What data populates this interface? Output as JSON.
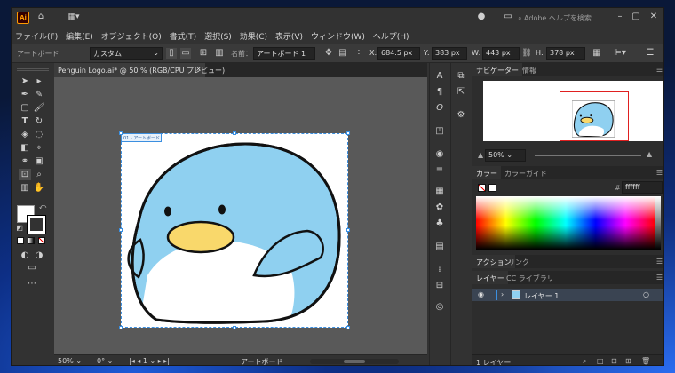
{
  "app": {
    "logo": "Ai"
  },
  "search": {
    "placeholder": "Adobe ヘルプを検索"
  },
  "menu": [
    "ファイル(F)",
    "編集(E)",
    "オブジェクト(O)",
    "書式(T)",
    "選択(S)",
    "効果(C)",
    "表示(V)",
    "ウィンドウ(W)",
    "ヘルプ(H)"
  ],
  "control": {
    "label": "アートボード",
    "preset": "カスタム",
    "name_label": "名前：",
    "name_value": "アートボード 1",
    "x_label": "X:",
    "x_value": "684.5 px",
    "y_label": "Y:",
    "y_value": "383 px",
    "w_label": "W:",
    "w_value": "443 px",
    "h_label": "H:",
    "h_value": "378 px"
  },
  "document_tab": {
    "title": "Penguin Logo.ai* @ 50 % (RGB/CPU プレビュー)",
    "close": "×"
  },
  "artboard": {
    "label": "01 - アートボード 1"
  },
  "status": {
    "zoom": "50%",
    "rotate": "0°",
    "artboard_num": "1",
    "mode": "アートボード"
  },
  "navigator": {
    "tab1": "ナビゲーター",
    "tab2": "情報",
    "zoom": "50%"
  },
  "color": {
    "tab1": "カラー",
    "tab2": "カラーガイド",
    "hash": "#",
    "hex": "ffffff"
  },
  "actions": {
    "tab1": "アクション",
    "tab2": "リンク"
  },
  "layers": {
    "tab1": "レイヤー",
    "tab2": "CC ライブラリ",
    "layer_name": "レイヤー 1",
    "footer": "1 レイヤー"
  },
  "colors": {
    "body": "#8fd0f0",
    "beak": "#f9d86b",
    "outline": "#111111",
    "belly": "#ffffff",
    "artboard_sel": "#3b8fe0"
  }
}
